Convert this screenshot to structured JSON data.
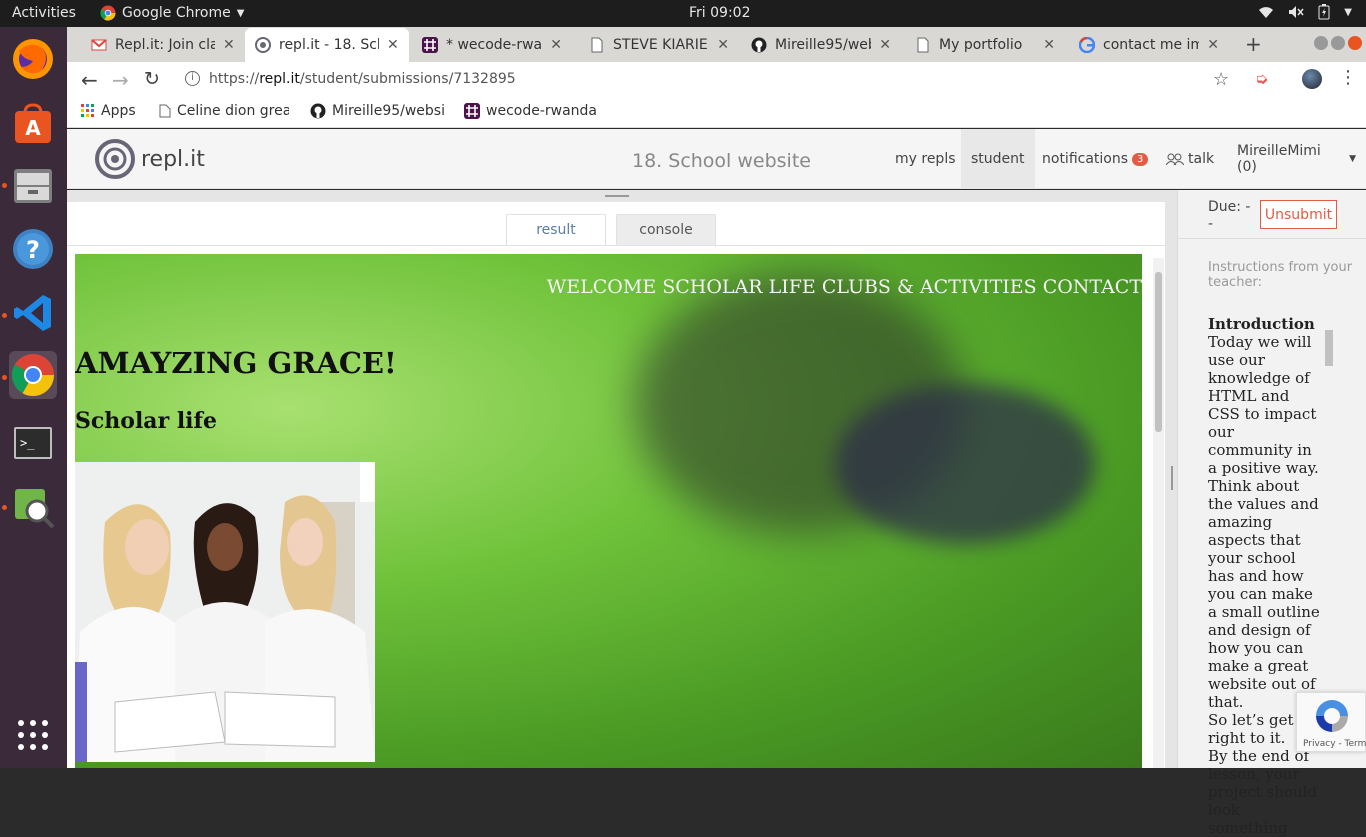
{
  "system": {
    "activities_label": "Activities",
    "app_name": "Google Chrome",
    "clock": "Fri 09:02"
  },
  "dock": {
    "apps": [
      "firefox-icon",
      "software-center-icon",
      "files-icon",
      "help-icon",
      "vscode-icon",
      "chrome-icon",
      "terminal-icon",
      "system-monitor-icon",
      "app-grid-icon"
    ]
  },
  "tabs": [
    {
      "label": "Repl.it: Join cla",
      "icon": "gmail-icon"
    },
    {
      "label": "repl.it - 18. Sch",
      "icon": "replit-icon"
    },
    {
      "label": "* wecode-rwan",
      "icon": "slack-icon"
    },
    {
      "label": "STEVE KIARIE",
      "icon": "page-icon"
    },
    {
      "label": "Mireille95/web",
      "icon": "github-icon"
    },
    {
      "label": "My portfolio",
      "icon": "page-icon"
    },
    {
      "label": "contact me im",
      "icon": "google-icon"
    }
  ],
  "address_bar": {
    "url_prefix": "https://",
    "url_domain": "repl.it",
    "url_path": "/student/submissions/7132895"
  },
  "bookmarks": [
    {
      "label": "Apps",
      "icon": "apps-grid-icon"
    },
    {
      "label": "Celine dion grea",
      "icon": "page-icon"
    },
    {
      "label": "Mireille95/websi",
      "icon": "github-icon"
    },
    {
      "label": "wecode-rwanda",
      "icon": "slack-icon"
    }
  ],
  "replit": {
    "logo_text": "repl.it",
    "project_title": "18. School website",
    "nav": {
      "my_repls": "my repls",
      "student": "student",
      "notifications": "notifications",
      "notifications_count": "3",
      "talk": "talk",
      "user": "MireilleMimi (0)"
    },
    "output_tabs": {
      "result": "result",
      "console": "console"
    }
  },
  "website": {
    "nav_text": "WELCOME SCHOLAR LIFE CLUBS & ACTIVITIES CONTACT",
    "heading": "AMAYZING GRACE!",
    "subheading": "Scholar life"
  },
  "sidebar": {
    "due_label": "Due: - -",
    "unsubmit_label": "Unsubmit",
    "instructions_label": "Instructions from your teacher:",
    "intro_title": "Introduction",
    "instructions_text": "Today we will use our knowledge of HTML and CSS to impact our community in a positive way. Think about the values and amazing aspects that your school has and how you can make a small outline and design of how you can make a great website out of that.",
    "line2": "So let’s get right to it.",
    "line3": "By the end of lesson, your project should look something"
  },
  "captcha": {
    "footer": "Privacy - Terms"
  }
}
